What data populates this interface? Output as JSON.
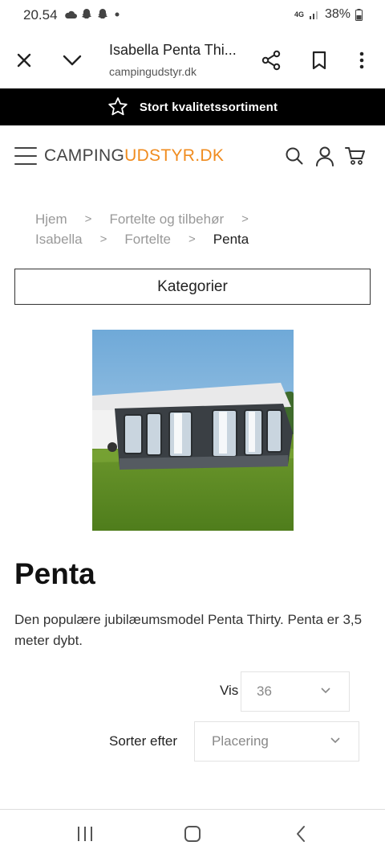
{
  "status_bar": {
    "time": "20.54",
    "network": "4G",
    "battery": "38%",
    "left_icons": [
      "cloud-icon",
      "snapchat-icon",
      "snapchat-icon",
      "dot-icon"
    ]
  },
  "browser": {
    "title": "Isabella Penta Thi...",
    "url": "campingudstyr.dk"
  },
  "promo": {
    "text": "Stort kvalitetssortiment",
    "icon": "star-outline-icon"
  },
  "logo": {
    "part1": "CAMPING",
    "part2": "UDSTYR.DK",
    "accent_color": "#f08c1f"
  },
  "breadcrumb": {
    "items": [
      "Hjem",
      "Fortelte og tilbehør",
      "Isabella",
      "Fortelte",
      "Penta"
    ]
  },
  "categories_button": "Kategorier",
  "product": {
    "title": "Penta",
    "description": "Den populære jubilæumsmodel Penta Thirty. Penta er 3,5 meter dybt."
  },
  "controls": {
    "show_label": "Vis",
    "show_value": "36",
    "sort_label": "Sorter efter",
    "sort_value": "Placering"
  }
}
